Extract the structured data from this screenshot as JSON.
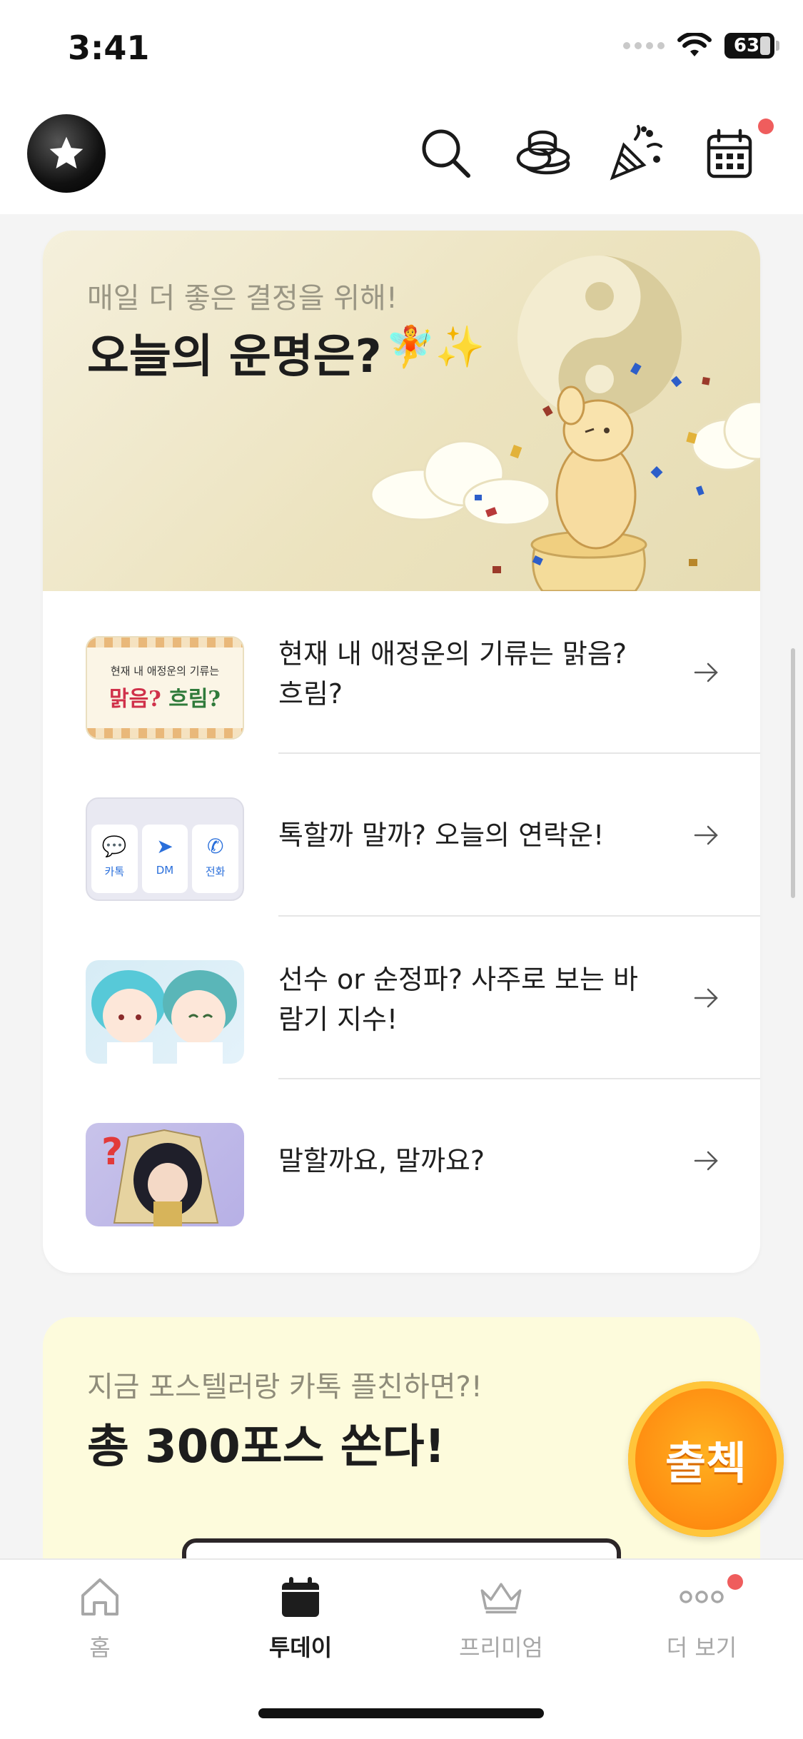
{
  "status": {
    "time": "3:41",
    "battery": "63"
  },
  "header": {
    "logo": "star-logo",
    "icons": [
      "search-icon",
      "coins-icon",
      "party-popper-icon",
      "calendar-icon"
    ],
    "accent": "#ef5d5d"
  },
  "fortune_card": {
    "subtitle": "매일 더 좋은 결정을 위해!",
    "title": "오늘의 운명은?",
    "title_emoji": "🧚✨",
    "items": [
      {
        "thumb_text_top": "현재 내 애정운의 기류는",
        "thumb_text_left": "맑음?",
        "thumb_text_right": "흐림?",
        "label": "현재 내 애정운의 기류는 맑음? 흐림?"
      },
      {
        "thumb_buttons": [
          "카톡",
          "DM",
          "전화"
        ],
        "label": "톡할까 말까? 오늘의 연락운!"
      },
      {
        "label": "선수 or 순정파? 사주로 보는 바람기 지수!"
      },
      {
        "label": "말할까요, 말까요?"
      }
    ]
  },
  "promo_card": {
    "subtitle": "지금 포스텔러랑 카톡 플친하면?!",
    "title": "총 300포스 쏜다!",
    "badge": "출첵"
  },
  "tabbar": {
    "tabs": [
      {
        "label": "홈",
        "icon": "home-icon",
        "active": false
      },
      {
        "label": "투데이",
        "icon": "calendar-icon",
        "active": true
      },
      {
        "label": "프리미엄",
        "icon": "crown-icon",
        "active": false
      },
      {
        "label": "더 보기",
        "icon": "more-icon",
        "active": false
      }
    ]
  }
}
